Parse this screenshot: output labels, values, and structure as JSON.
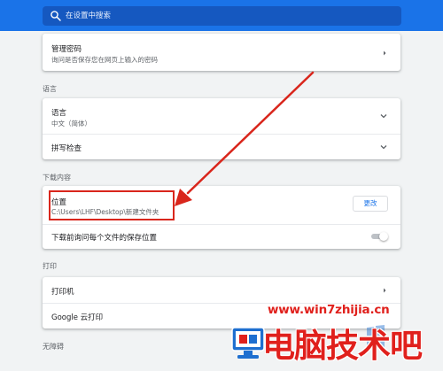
{
  "search": {
    "placeholder": "在设置中搜索",
    "icon": "search-icon"
  },
  "autofill": {
    "password_row": {
      "label": "管理密码",
      "sublabel": "询问是否保存您在网页上输入的密码"
    }
  },
  "languages": {
    "title": "语言",
    "language_row": {
      "label": "语言",
      "sublabel": "中文（简体）"
    },
    "spellcheck_row": {
      "label": "拼写检查"
    }
  },
  "downloads": {
    "title": "下载内容",
    "location_row": {
      "label": "位置",
      "path": "C:\\Users\\LHF\\Desktop\\新建文件夹",
      "button": "更改"
    },
    "ask_row": {
      "label": "下载前询问每个文件的保存位置",
      "enabled": false
    }
  },
  "printing": {
    "title": "打印",
    "printers_row": {
      "label": "打印机"
    },
    "cloud_print_row": {
      "label": "Google 云打印"
    }
  },
  "accessibility": {
    "title": "无障碍"
  },
  "watermark": {
    "url": "www.win7zhijia.cn",
    "brand": "电脑技术吧"
  },
  "colors": {
    "accent": "#1a73e8",
    "annotation": "#d9261c",
    "watermark": "#e0201c"
  }
}
